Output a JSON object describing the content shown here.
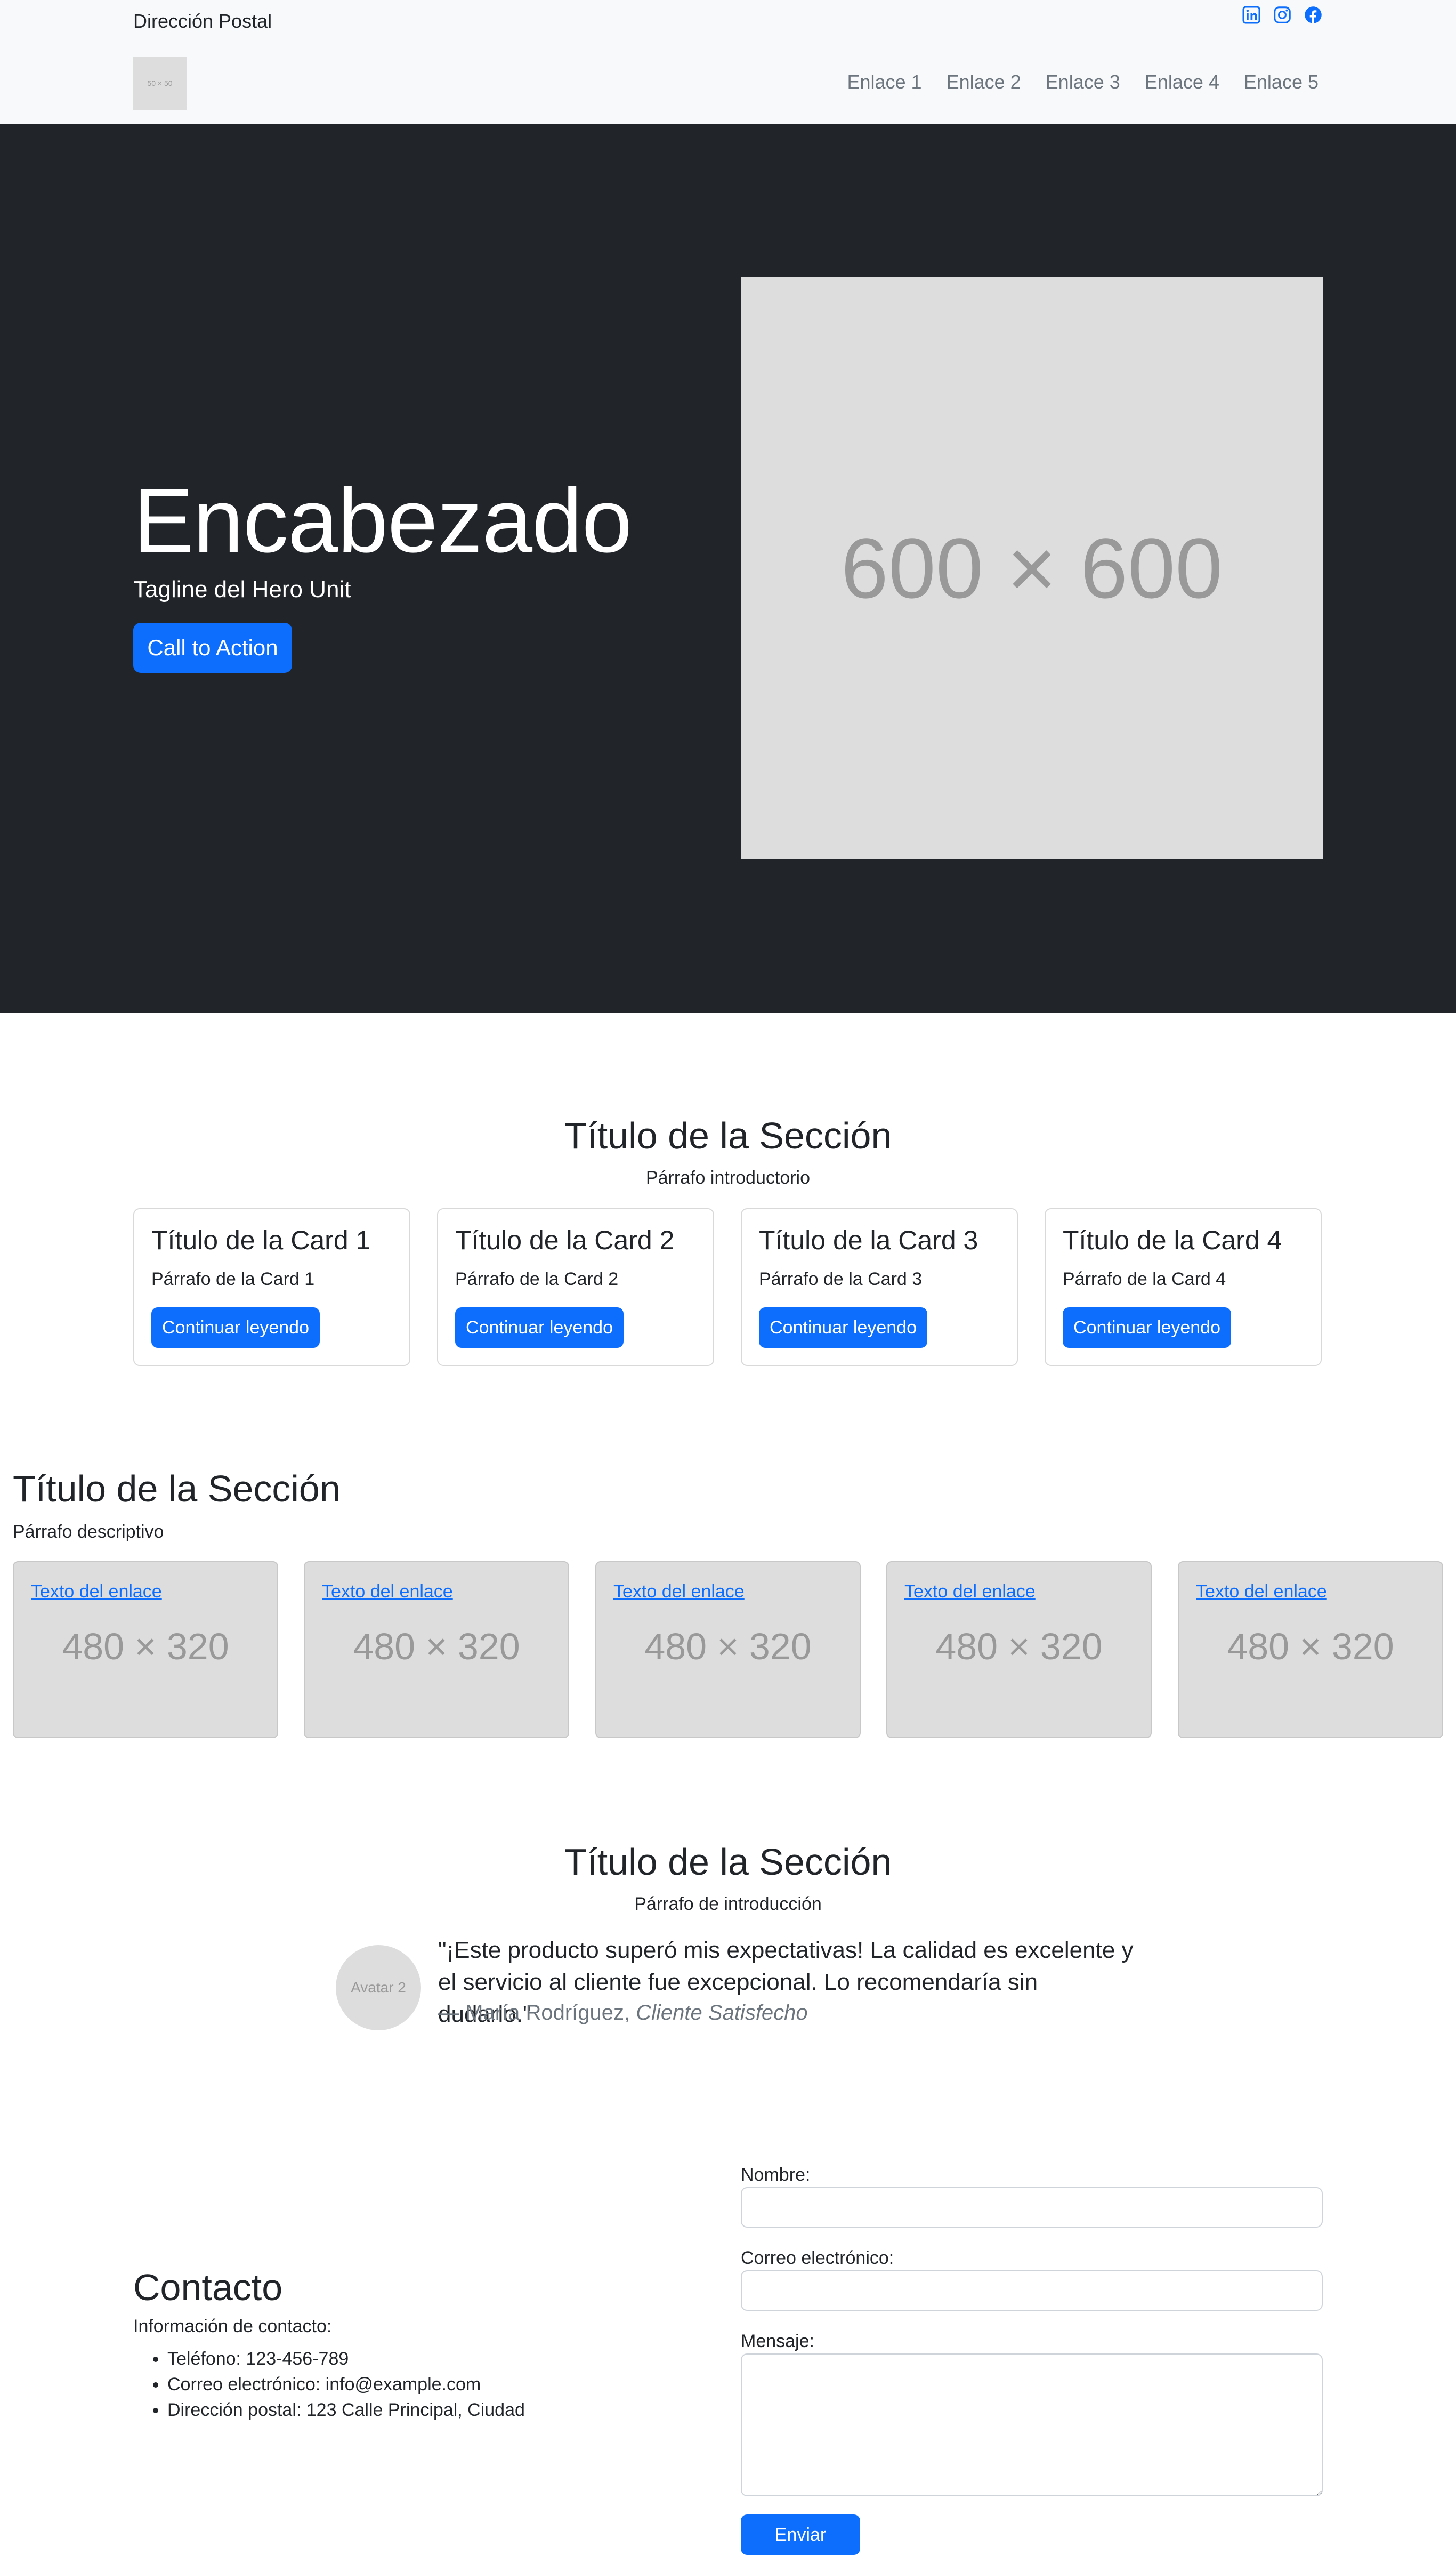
{
  "header": {
    "postal": "Dirección Postal",
    "logo_text": "50 × 50",
    "social": [
      {
        "icon": "linkedin-icon"
      },
      {
        "icon": "instagram-icon"
      },
      {
        "icon": "facebook-icon"
      }
    ],
    "nav": [
      "Enlace 1",
      "Enlace 2",
      "Enlace 3",
      "Enlace 4",
      "Enlace 5"
    ]
  },
  "hero": {
    "title": "Encabezado",
    "tagline": "Tagline del Hero Unit",
    "cta": "Call to Action",
    "image_text": "600 × 600"
  },
  "cards_section": {
    "title": "Título de la Sección",
    "intro": "Párrafo introductorio",
    "cards": [
      {
        "title": "Título de la Card 1",
        "text": "Párrafo de la Card 1",
        "button": "Continuar leyendo"
      },
      {
        "title": "Título de la Card 2",
        "text": "Párrafo de la Card 2",
        "button": "Continuar leyendo"
      },
      {
        "title": "Título de la Card 3",
        "text": "Párrafo de la Card 3",
        "button": "Continuar leyendo"
      },
      {
        "title": "Título de la Card 4",
        "text": "Párrafo de la Card 4",
        "button": "Continuar leyendo"
      }
    ]
  },
  "gallery_section": {
    "title": "Título de la Sección",
    "description": "Párrafo descriptivo",
    "items": [
      {
        "link": "Texto del enlace",
        "image_text": "480 × 320"
      },
      {
        "link": "Texto del enlace",
        "image_text": "480 × 320"
      },
      {
        "link": "Texto del enlace",
        "image_text": "480 × 320"
      },
      {
        "link": "Texto del enlace",
        "image_text": "480 × 320"
      },
      {
        "link": "Texto del enlace",
        "image_text": "480 × 320"
      }
    ]
  },
  "testimonial_section": {
    "title": "Título de la Sección",
    "intro": "Párrafo de introducción",
    "avatar_text": "Avatar 2",
    "quote": "\"¡Este producto superó mis expectativas! La calidad es excelente y el servicio al cliente fue excepcional. Lo recomendaría sin dudarlo.\"",
    "author_prefix": "— ",
    "author": "María Rodríguez, ",
    "author_role": "Cliente Satisfecho"
  },
  "contact_section": {
    "title": "Contacto",
    "info": "Información de contacto:",
    "list": [
      "Teléfono: 123-456-789",
      "Correo electrónico: info@example.com",
      "Dirección postal: 123 Calle Principal, Ciudad"
    ],
    "form": {
      "name_label": "Nombre:",
      "email_label": "Correo electrónico:",
      "message_label": "Mensaje:",
      "submit": "Enviar"
    }
  },
  "colors": {
    "primary": "#0d6efd",
    "hero_bg": "#212529",
    "header_bg": "#f8f9fa",
    "placeholder_bg": "#dddddd"
  }
}
